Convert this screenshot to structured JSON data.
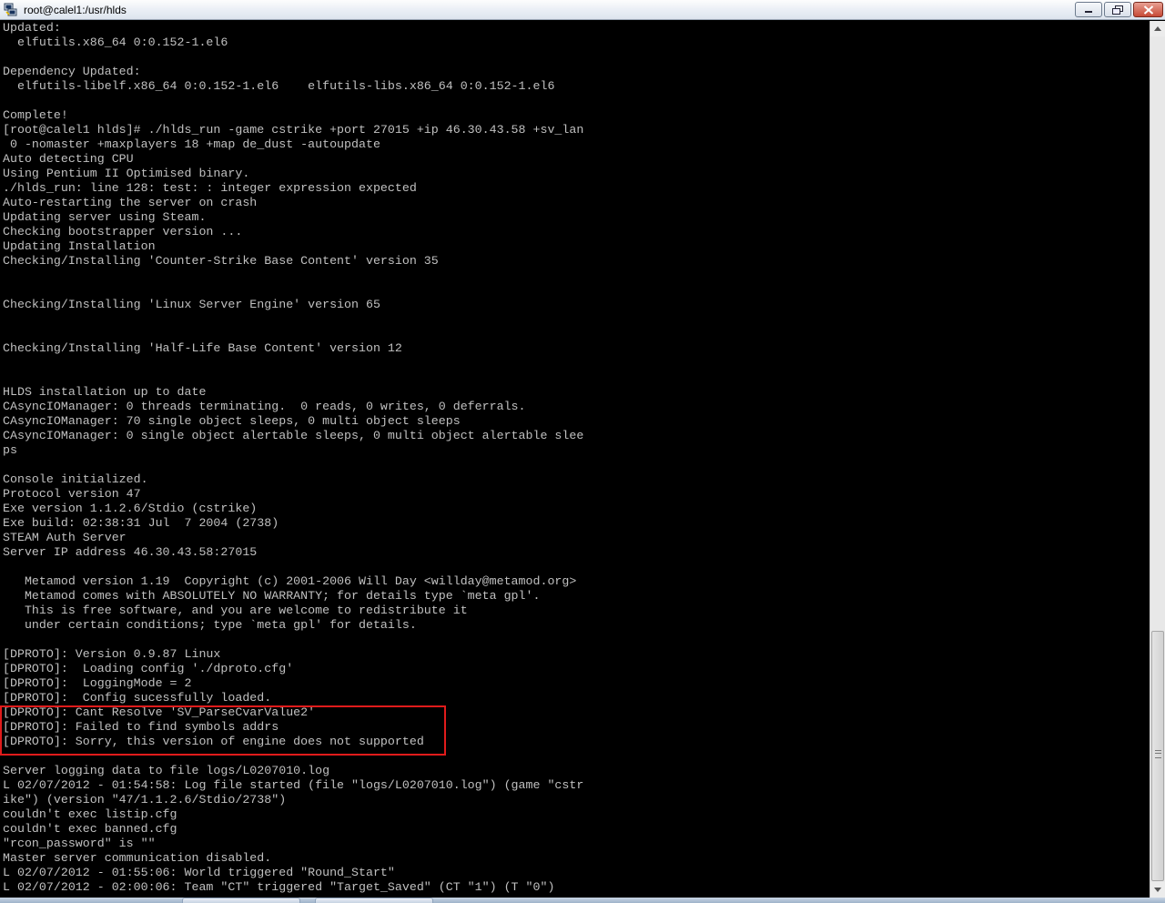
{
  "window": {
    "title": "root@calel1:/usr/hlds",
    "app_icon": "putty-icon",
    "buttons": {
      "minimize": "minimize-icon",
      "maximize": "maximize-icon",
      "close": "close-icon"
    }
  },
  "terminal": {
    "lines": [
      "Updated:",
      "  elfutils.x86_64 0:0.152-1.el6",
      "",
      "Dependency Updated:",
      "  elfutils-libelf.x86_64 0:0.152-1.el6    elfutils-libs.x86_64 0:0.152-1.el6",
      "",
      "Complete!",
      "[root@calel1 hlds]# ./hlds_run -game cstrike +port 27015 +ip 46.30.43.58 +sv_lan",
      " 0 -nomaster +maxplayers 18 +map de_dust -autoupdate",
      "Auto detecting CPU",
      "Using Pentium II Optimised binary.",
      "./hlds_run: line 128: test: : integer expression expected",
      "Auto-restarting the server on crash",
      "Updating server using Steam.",
      "Checking bootstrapper version ...",
      "Updating Installation",
      "Checking/Installing 'Counter-Strike Base Content' version 35",
      "",
      "",
      "Checking/Installing 'Linux Server Engine' version 65",
      "",
      "",
      "Checking/Installing 'Half-Life Base Content' version 12",
      "",
      "",
      "HLDS installation up to date",
      "CAsyncIOManager: 0 threads terminating.  0 reads, 0 writes, 0 deferrals.",
      "CAsyncIOManager: 70 single object sleeps, 0 multi object sleeps",
      "CAsyncIOManager: 0 single object alertable sleeps, 0 multi object alertable slee",
      "ps",
      "",
      "Console initialized.",
      "Protocol version 47",
      "Exe version 1.1.2.6/Stdio (cstrike)",
      "Exe build: 02:38:31 Jul  7 2004 (2738)",
      "STEAM Auth Server",
      "Server IP address 46.30.43.58:27015",
      "",
      "   Metamod version 1.19  Copyright (c) 2001-2006 Will Day <willday@metamod.org>",
      "   Metamod comes with ABSOLUTELY NO WARRANTY; for details type `meta gpl'.",
      "   This is free software, and you are welcome to redistribute it",
      "   under certain conditions; type `meta gpl' for details.",
      "",
      "[DPROTO]: Version 0.9.87 Linux",
      "[DPROTO]:  Loading config './dproto.cfg'",
      "[DPROTO]:  LoggingMode = 2",
      "[DPROTO]:  Config sucessfully loaded.",
      "[DPROTO]: Cant Resolve 'SV_ParseCvarValue2'",
      "[DPROTO]: Failed to find symbols addrs",
      "[DPROTO]: Sorry, this version of engine does not supported",
      "",
      "Server logging data to file logs/L0207010.log",
      "L 02/07/2012 - 01:54:58: Log file started (file \"logs/L0207010.log\") (game \"cstr",
      "ike\") (version \"47/1.1.2.6/Stdio/2738\")",
      "couldn't exec listip.cfg",
      "couldn't exec banned.cfg",
      "\"rcon_password\" is \"\"",
      "Master server communication disabled.",
      "L 02/07/2012 - 01:55:06: World triggered \"Round_Start\"",
      "L 02/07/2012 - 02:00:06: Team \"CT\" triggered \"Target_Saved\" (CT \"1\") (T \"0\")"
    ],
    "highlight_color": "#e01b1b",
    "text_color": "#c0c0c0",
    "background_color": "#000000"
  }
}
